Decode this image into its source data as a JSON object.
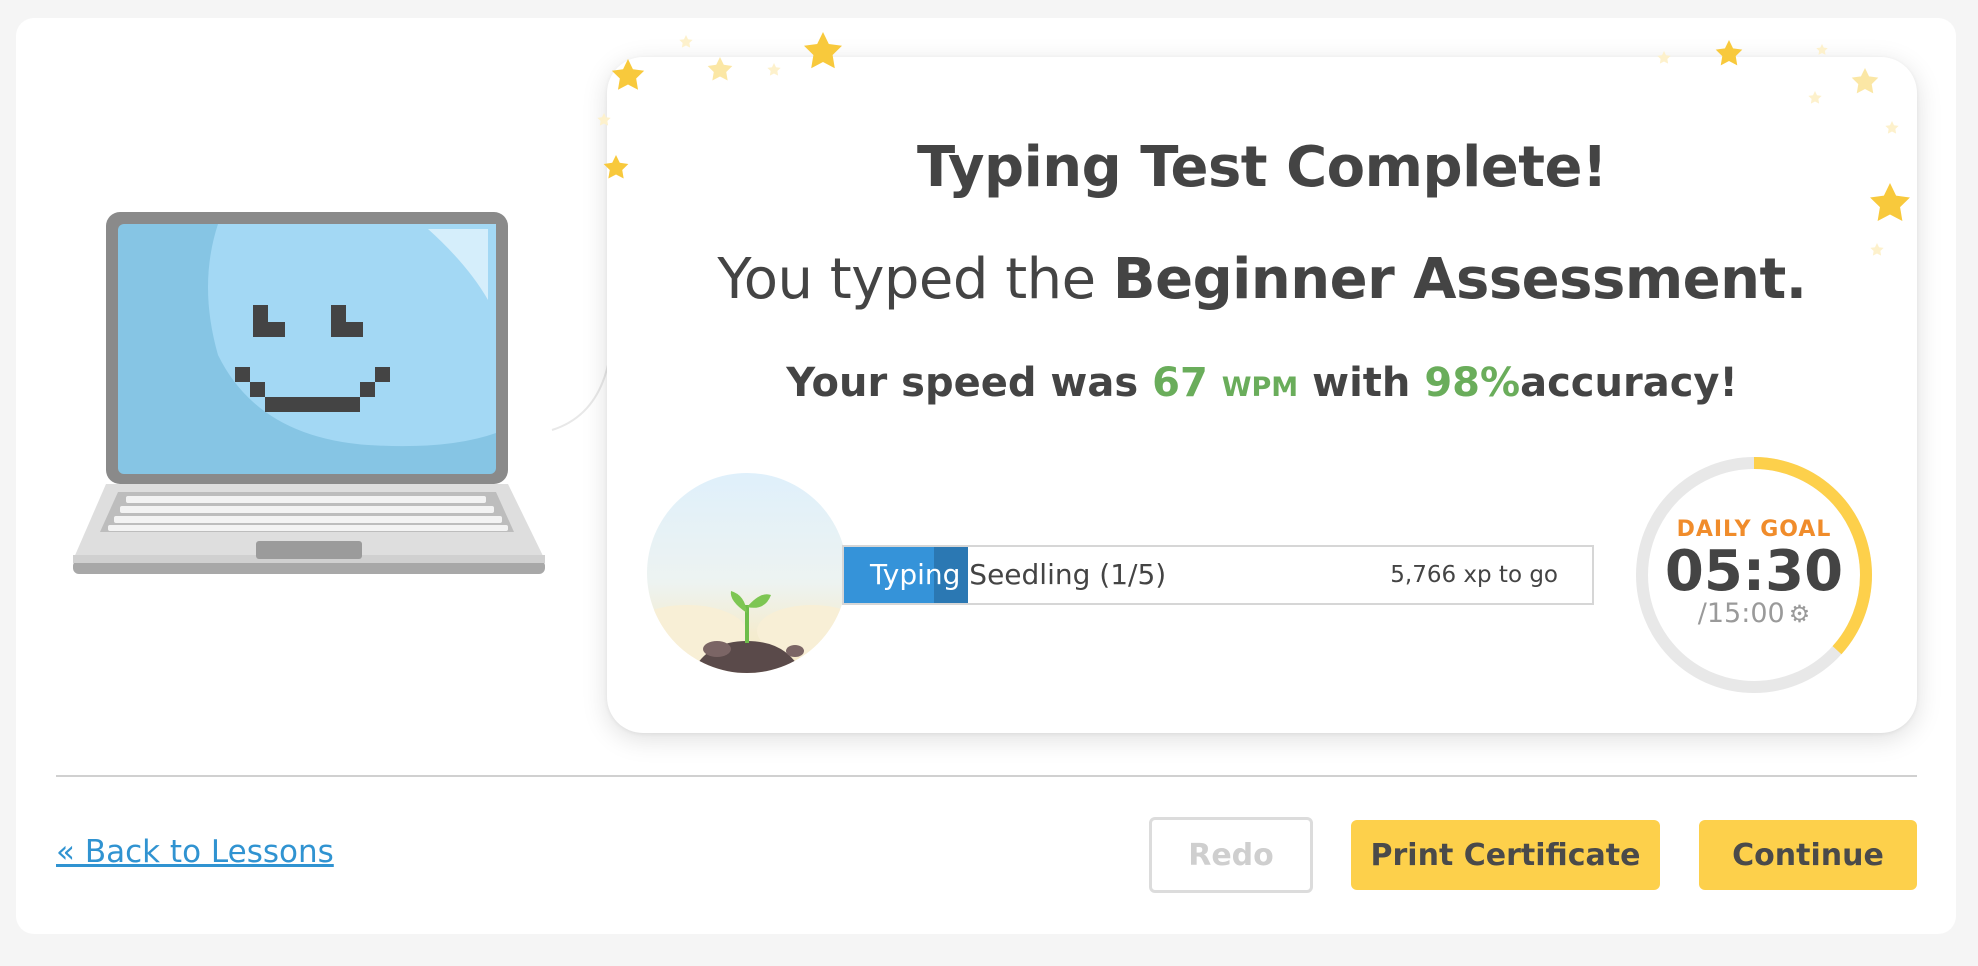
{
  "result": {
    "title": "Typing Test Complete!",
    "subtitle_prefix": "You typed the",
    "subtitle_test": "Beginner Assessment.",
    "speed_prefix": "Your speed was",
    "speed_value": "67",
    "speed_unit": "WPM",
    "accuracy_prefix": "with",
    "accuracy_value": "98%",
    "accuracy_suffix": "accuracy!"
  },
  "level": {
    "track_name": "Typing",
    "level_name": "Seedling (1/5)",
    "xp_to_go": "5,766 xp to go",
    "progress_fraction": 0.166
  },
  "daily_goal": {
    "label": "DAILY GOAL",
    "time_done": "05:30",
    "time_total": "/15:00",
    "progress_fraction": 0.367
  },
  "nav": {
    "back_label": "« Back to Lessons",
    "redo_label": "Redo",
    "print_label": "Print Certificate",
    "continue_label": "Continue"
  },
  "colors": {
    "accent_yellow": "#fdd04b",
    "stat_green": "#6aad5b",
    "link_blue": "#3093d1",
    "progress_blue": "#3593d9",
    "goal_orange": "#f08c2b"
  },
  "icons": [
    "laptop-mascot-icon",
    "star-icon",
    "seedling-icon",
    "gear-icon"
  ]
}
